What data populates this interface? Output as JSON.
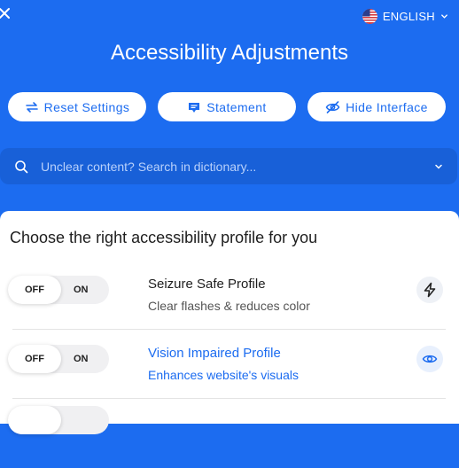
{
  "header": {
    "language_label": "ENGLISH",
    "title": "Accessibility Adjustments"
  },
  "actions": {
    "reset_label": "Reset Settings",
    "statement_label": "Statement",
    "hide_label": "Hide Interface"
  },
  "search": {
    "placeholder": "Unclear content? Search in dictionary...",
    "value": ""
  },
  "profiles": {
    "heading": "Choose the right accessibility profile for you",
    "items": [
      {
        "name": "Seizure Safe Profile",
        "description": "Clear flashes & reduces color",
        "off_label": "OFF",
        "on_label": "ON",
        "state": "OFF",
        "icon": "bolt-icon"
      },
      {
        "name": "Vision Impaired Profile",
        "description": "Enhances website's visuals",
        "off_label": "OFF",
        "on_label": "ON",
        "state": "OFF",
        "icon": "eye-icon"
      }
    ]
  },
  "colors": {
    "brand": "#1c6cf0",
    "search_bg": "#1860d8",
    "panel_bg": "#ffffff"
  }
}
